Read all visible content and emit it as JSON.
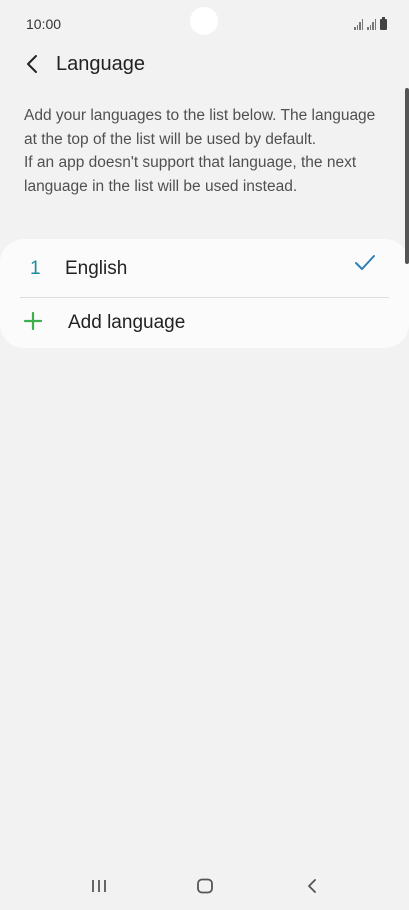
{
  "status_bar": {
    "time": "10:00"
  },
  "header": {
    "title": "Language",
    "back_icon": "chevron-left-icon"
  },
  "description": {
    "line1": "Add your languages to the list below. The language at the top of the list will be used by default.",
    "line2": "If an app doesn't support that language, the next language in the list will be used instead."
  },
  "languages": [
    {
      "index": "1",
      "name": "English",
      "selected": true
    }
  ],
  "add_language": {
    "label": "Add language",
    "icon": "plus-icon"
  },
  "colors": {
    "accent_teal": "#1a8ba0",
    "check_blue": "#2e7fb8",
    "plus_green": "#3db04b",
    "background": "#f2f2f2",
    "card": "#fbfbfb"
  },
  "nav_bar": {
    "recents_icon": "recents-icon",
    "home_icon": "home-icon",
    "back_icon": "back-icon"
  }
}
